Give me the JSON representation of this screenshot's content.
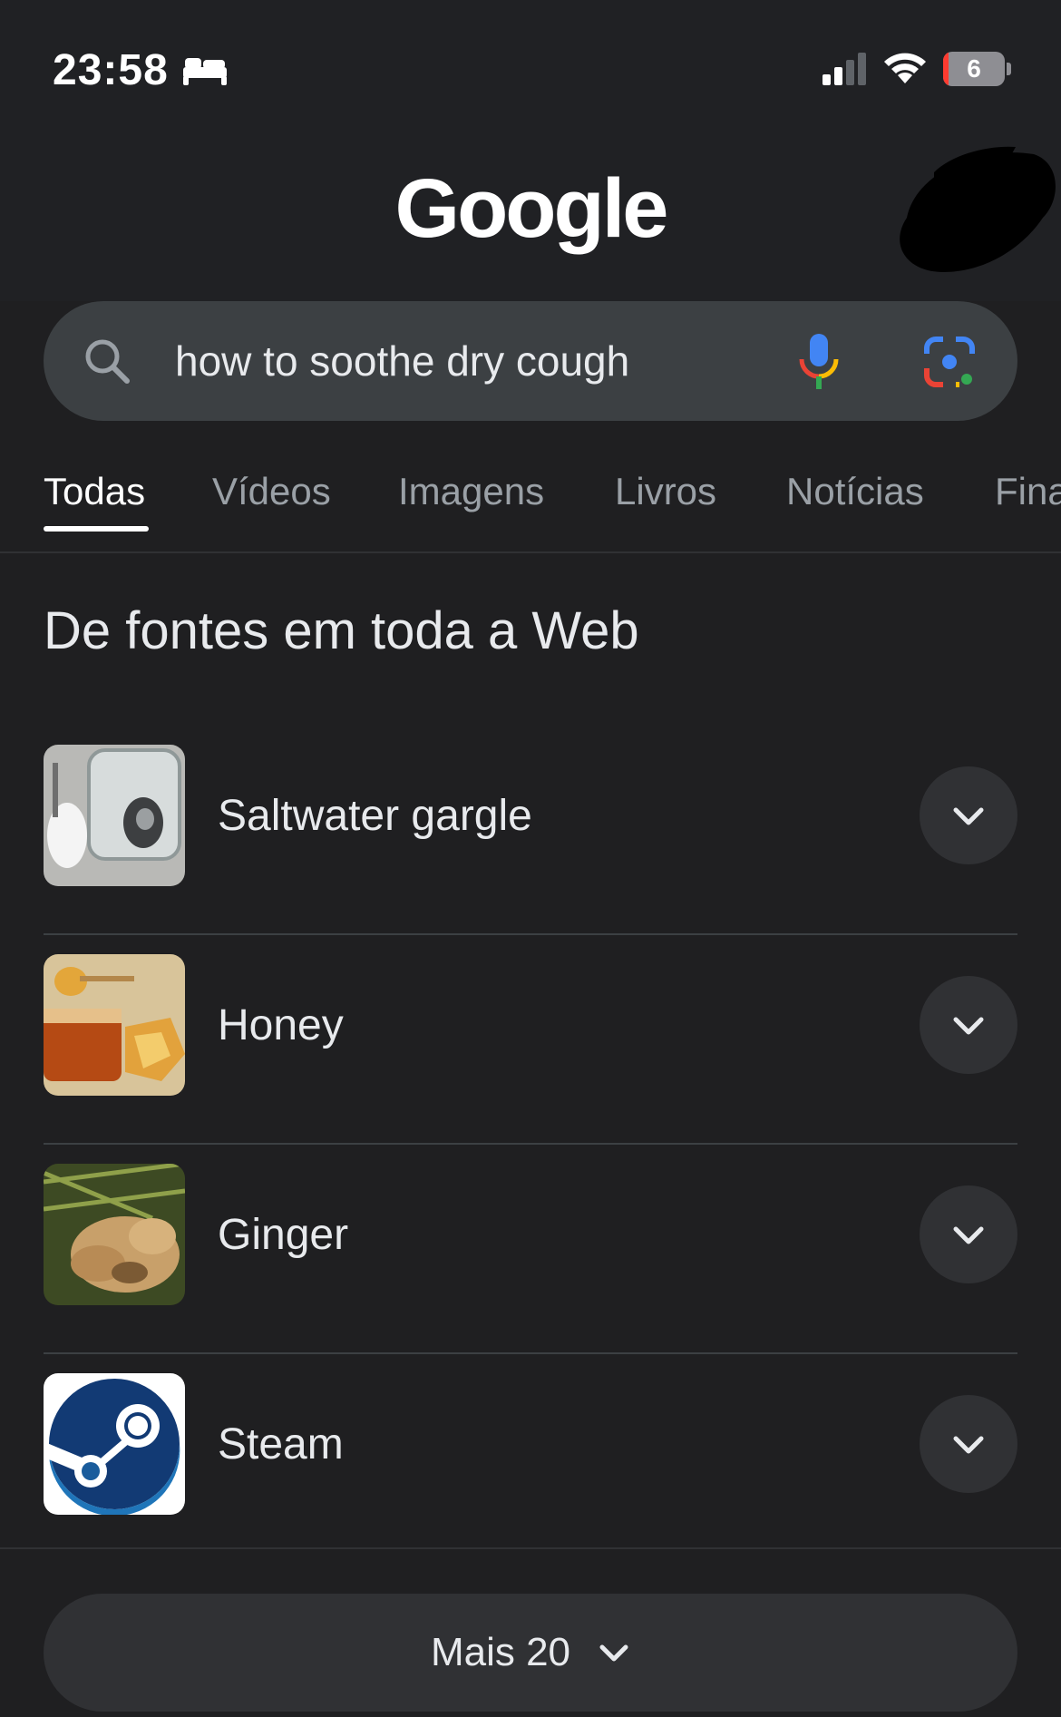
{
  "status_bar": {
    "time": "23:58",
    "battery_level": "6",
    "battery_fraction": 0.06,
    "icons": [
      "bed-icon",
      "cellular-signal-icon",
      "wifi-icon",
      "battery-icon"
    ]
  },
  "header": {
    "logo_text": "Google"
  },
  "search": {
    "query": "how to soothe dry cough",
    "icons": [
      "search-icon",
      "mic-icon",
      "google-lens-icon"
    ]
  },
  "tabs": [
    {
      "label": "Todas",
      "active": true
    },
    {
      "label": "Vídeos",
      "active": false
    },
    {
      "label": "Imagens",
      "active": false
    },
    {
      "label": "Livros",
      "active": false
    },
    {
      "label": "Notícias",
      "active": false
    },
    {
      "label": "Fina",
      "active": false
    }
  ],
  "section": {
    "title": "De fontes em toda a Web"
  },
  "items": [
    {
      "label": "Saltwater gargle",
      "thumbnail": "saltwater-thumbnail"
    },
    {
      "label": "Honey",
      "thumbnail": "honey-thumbnail"
    },
    {
      "label": "Ginger",
      "thumbnail": "ginger-thumbnail"
    },
    {
      "label": "Steam",
      "thumbnail": "steam-logo-thumbnail"
    }
  ],
  "more": {
    "label": "Mais 20"
  },
  "colors": {
    "background": "#1f1f21",
    "surface": "#303134",
    "search_bar": "#3c4043",
    "text": "#e8eaed",
    "muted": "#9aa0a6",
    "google_blue": "#4285f4",
    "google_red": "#ea4335",
    "google_yellow": "#fbbc05",
    "google_green": "#34a853"
  }
}
